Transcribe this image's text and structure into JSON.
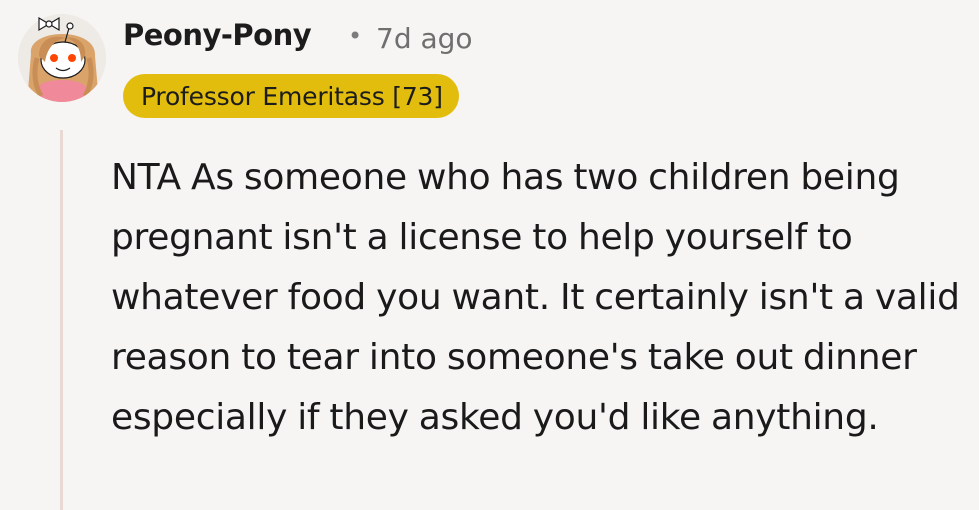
{
  "comment": {
    "username": "Peony-Pony",
    "separator": "•",
    "timestamp": "7d ago",
    "flair": "Professor Emeritass [73]",
    "body": "NTA As someone who has two children being pregnant isn't a license to help yourself to whatever food you want. It certainly isn't a valid reason to tear into someone's take out dinner especially if they asked you'd like anything."
  },
  "colors": {
    "background": "#f6f5f4",
    "flair_background": "#e3bd0d",
    "thread_line": "#e8d9d5",
    "timestamp": "#6f6f6f"
  },
  "icons": {
    "avatar": "snoo-avatar-icon"
  }
}
